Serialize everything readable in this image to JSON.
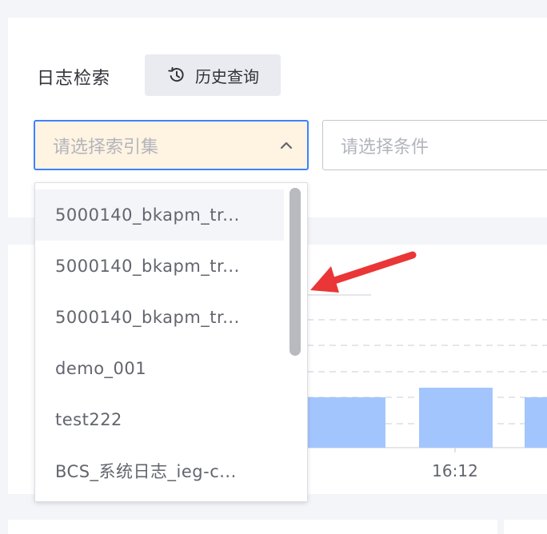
{
  "search": {
    "title": "日志检索",
    "history_label": "历史查询",
    "index_placeholder": "请选择索引集",
    "condition_placeholder": "请选择条件"
  },
  "dropdown": {
    "options": [
      "5000140_bkapm_tr...",
      "5000140_bkapm_tr...",
      "5000140_bkapm_tr...",
      "demo_001",
      "test222",
      "BCS_系统日志_ieg-c..."
    ],
    "hovered_index": 0
  },
  "chart_data": {
    "type": "bar",
    "x_tick_labels": [
      "16:12"
    ],
    "bar_color": "#a3c5fd",
    "grid": true
  },
  "annotation": {
    "arrow_color": "#ea3636"
  }
}
